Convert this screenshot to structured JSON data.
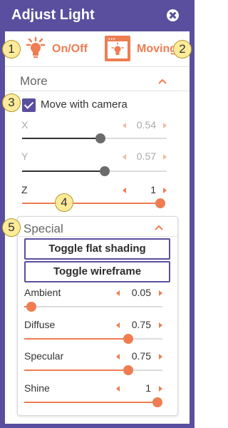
{
  "window": {
    "title": "Adjust Light"
  },
  "modes": {
    "on_off_label": "On/Off",
    "moving_label": "Moving"
  },
  "callouts": [
    "1",
    "2",
    "3",
    "4",
    "5"
  ],
  "more": {
    "heading": "More",
    "move_with_camera": {
      "label": "Move with camera",
      "checked": true
    },
    "params": [
      {
        "name": "X",
        "value": "0.54",
        "fraction": 0.54,
        "enabled": false
      },
      {
        "name": "Y",
        "value": "0.57",
        "fraction": 0.57,
        "enabled": false
      },
      {
        "name": "Z",
        "value": "1",
        "fraction": 1.0,
        "enabled": true
      }
    ]
  },
  "special": {
    "heading": "Special",
    "buttons": {
      "flat_shading": "Toggle flat shading",
      "wireframe": "Toggle wireframe"
    },
    "params": [
      {
        "name": "Ambient",
        "value": "0.05",
        "fraction": 0.05
      },
      {
        "name": "Diffuse",
        "value": "0.75",
        "fraction": 0.75
      },
      {
        "name": "Specular",
        "value": "0.75",
        "fraction": 0.75
      },
      {
        "name": "Shine",
        "value": "1",
        "fraction": 1.0
      }
    ]
  },
  "colors": {
    "accent": "#ee7d52",
    "purple": "#5a4f9e",
    "callout": "#fdeb9a"
  },
  "icons": [
    "close-icon",
    "lightbulb-icon",
    "window-lightbulb-icon",
    "chevron-up-icon",
    "check-icon",
    "arrow-left-icon",
    "arrow-right-icon"
  ]
}
